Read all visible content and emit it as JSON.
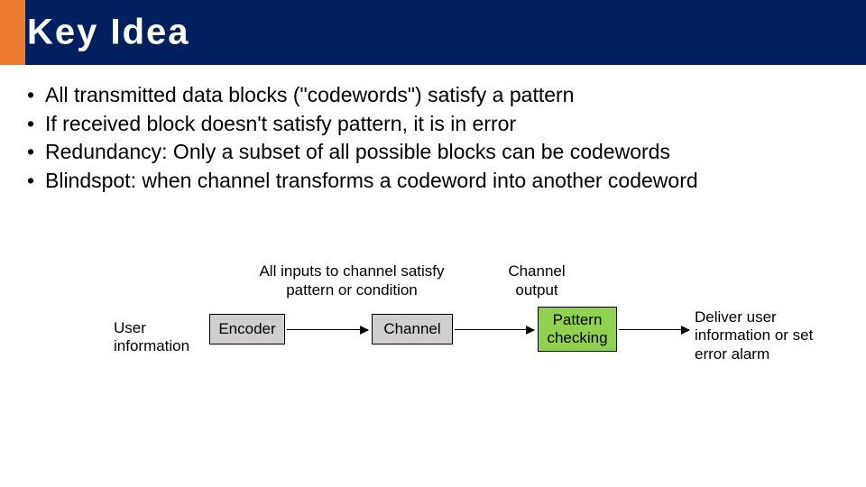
{
  "title": "Key Idea",
  "bullets": [
    "All transmitted data blocks (\"codewords\") satisfy a pattern",
    "If received block doesn't satisfy pattern, it is in error",
    "Redundancy:  Only a subset of all possible blocks can be codewords",
    "Blindspot:  when channel transforms a codeword into another codeword"
  ],
  "diagram": {
    "caption_inputs": "All inputs to channel satisfy pattern or condition",
    "caption_output": "Channel output",
    "user_label": "User information",
    "encoder": "Encoder",
    "channel": "Channel",
    "pattern": "Pattern checking",
    "deliver_label": "Deliver user information or set error alarm"
  }
}
